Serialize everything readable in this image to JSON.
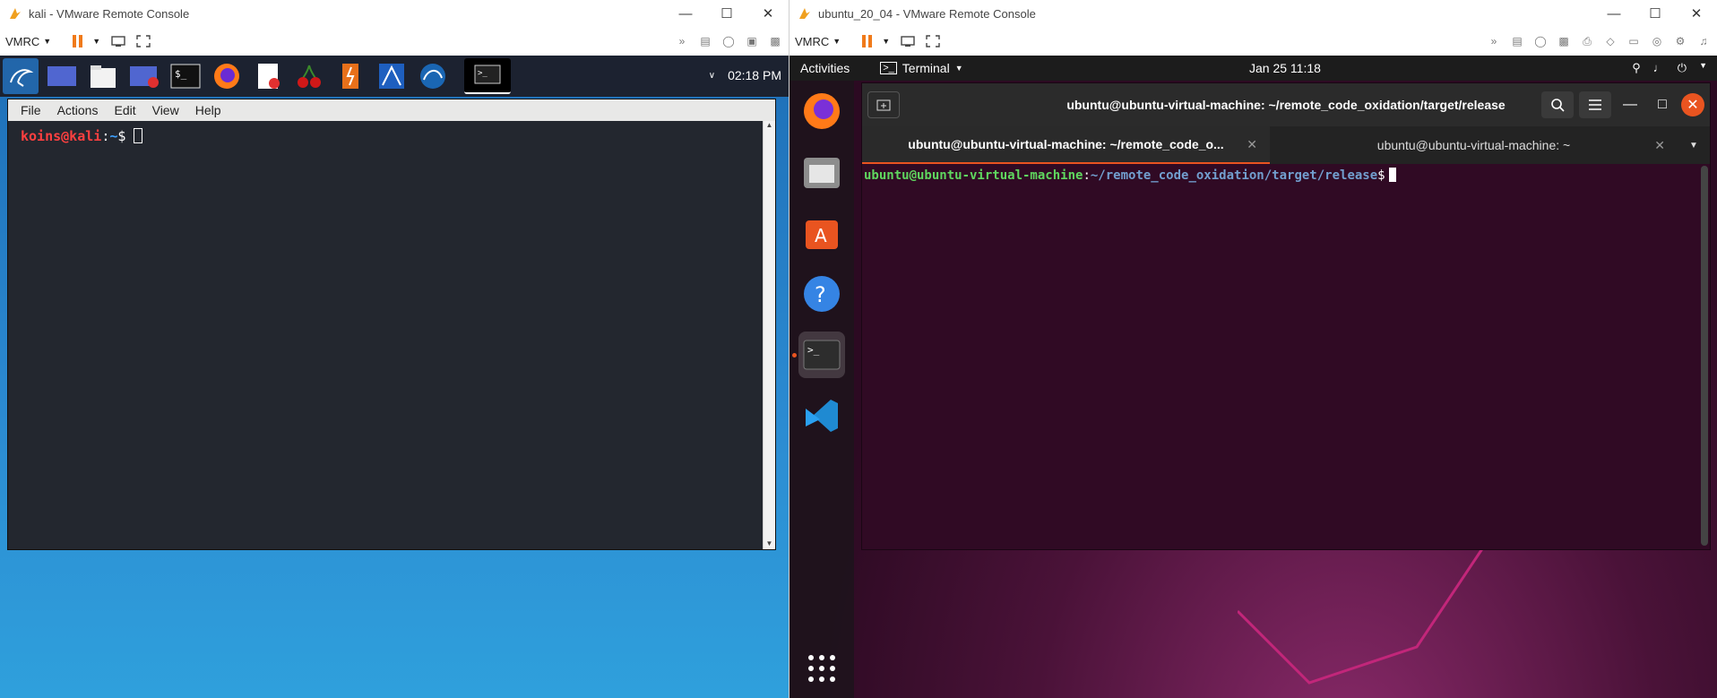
{
  "colors": {
    "kali_user": "#ff4040",
    "kali_path": "#3fa2ff",
    "ubuntu_user": "#5fd75f",
    "ubuntu_path": "#729fcf",
    "ubuntu_accent": "#e95420",
    "pause_orange": "#f07a1a"
  },
  "left_window": {
    "title": "kali - VMware Remote Console",
    "vmrc_menu": "VMRC",
    "panel_icons": [
      "kali-menu-icon",
      "workspace-icon",
      "file-manager-icon",
      "screen-recorder-icon",
      "terminal-icon",
      "firefox-icon",
      "text-editor-icon",
      "cherrytree-icon",
      "burpsuite-icon",
      "maltego-icon",
      "wireshark-icon",
      "active-terminal-icon"
    ],
    "clock": "02:18 PM",
    "terminal": {
      "menu": [
        "File",
        "Actions",
        "Edit",
        "View",
        "Help"
      ],
      "prompt_user": "koins@kali",
      "prompt_sep": ":",
      "prompt_path": "~",
      "prompt_symbol": "$"
    }
  },
  "right_window": {
    "title": "ubuntu_20_04 - VMware Remote Console",
    "vmrc_menu": "VMRC",
    "topbar": {
      "activities": "Activities",
      "app_menu": "Terminal",
      "datetime": "Jan 25  11:18"
    },
    "dock": [
      "firefox-icon",
      "files-icon",
      "software-icon",
      "help-icon",
      "terminal-icon",
      "vscode-icon",
      "show-apps-icon"
    ],
    "terminal": {
      "title": "ubuntu@ubuntu-virtual-machine: ~/remote_code_oxidation/target/release",
      "tabs": [
        {
          "label": "ubuntu@ubuntu-virtual-machine: ~/remote_code_o..."
        },
        {
          "label": "ubuntu@ubuntu-virtual-machine: ~"
        }
      ],
      "prompt_user": "ubuntu@ubuntu-virtual-machine",
      "prompt_sep": ":",
      "prompt_path": "~/remote_code_oxidation/target/release",
      "prompt_symbol": "$"
    }
  }
}
